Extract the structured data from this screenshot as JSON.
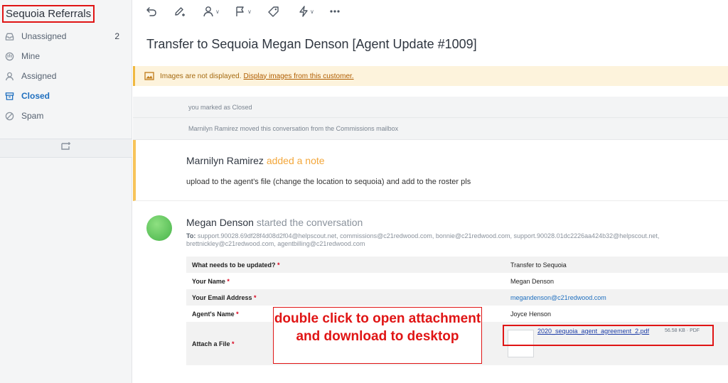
{
  "sidebar": {
    "mailbox_title": "Sequoia Referrals",
    "folders": [
      {
        "label": "Unassigned",
        "count": "2",
        "icon": "inbox-icon"
      },
      {
        "label": "Mine",
        "count": "",
        "icon": "hand-icon"
      },
      {
        "label": "Assigned",
        "count": "",
        "icon": "person-icon"
      },
      {
        "label": "Closed",
        "count": "",
        "icon": "archive-icon"
      },
      {
        "label": "Spam",
        "count": "",
        "icon": "block-icon"
      }
    ],
    "new_folder_icon": "new-folder-icon"
  },
  "toolbar": {
    "buttons": [
      "undo-icon",
      "edit-pencil-icon",
      "assign-person-icon",
      "flag-icon",
      "tag-icon",
      "workflow-bolt-icon",
      "more-icon"
    ]
  },
  "conversation": {
    "title": "Transfer to Sequoia Megan Denson [Agent Update #1009]",
    "banner": {
      "text": "Images are not displayed.",
      "link": "Display images from this customer."
    },
    "events": [
      "you marked as Closed",
      "Marnilyn Ramirez moved this conversation from the Commissions mailbox"
    ],
    "note": {
      "author": "Marnilyn Ramirez",
      "action": "added a note",
      "body": "upload to the agent's file (change the location to sequoia) and add to the roster pls"
    },
    "message": {
      "author": "Megan Denson",
      "action": "started the conversation",
      "to_label": "To:",
      "recipients": "support.90028.69df28f4d08d2f04@helpscout.net, commissions@c21redwood.com, bonnie@c21redwood.com, support.90028.01dc2226aa424b32@helpscout.net, brettnickley@c21redwood.com, agentbilling@c21redwood.com",
      "form": [
        {
          "key": "What needs to be updated?",
          "value": "Transfer to Sequoia"
        },
        {
          "key": "Your Name",
          "value": "Megan  Denson"
        },
        {
          "key": "Your Email Address",
          "value": "megandenson@c21redwood.com"
        },
        {
          "key": "Agent's Name",
          "value": "Joyce  Henson"
        },
        {
          "key": "Attach a File",
          "value": ""
        }
      ],
      "required_mark": "*",
      "attachment": {
        "name": "2020_sequoia_agent_agreement_2.pdf",
        "size": "56.58 KB",
        "separator": "·",
        "type": "PDF"
      }
    }
  },
  "annotation": {
    "callout": "double click to open attachment and download to desktop"
  },
  "colors": {
    "annotation_red": "#e01515",
    "note_accent": "#f7c45a",
    "link_blue": "#1f6fbf"
  }
}
